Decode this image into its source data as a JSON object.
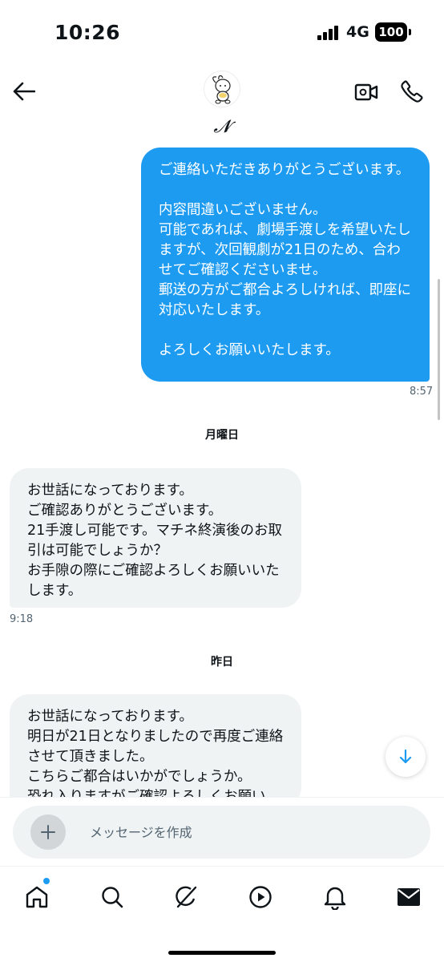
{
  "status_bar": {
    "time": "10:26",
    "network": "4G",
    "battery": "100"
  },
  "header": {
    "contact_name": "𝓝",
    "back_icon": "arrow-left-icon",
    "video_icon": "video-call-icon",
    "call_icon": "phone-icon"
  },
  "messages": [
    {
      "direction": "sent",
      "text": "ご連絡いただきありがとうございます。\n\n内容間違いございません。\n可能であれば、劇場手渡しを希望いたしますが、次回観劇が21日のため、合わせてご確認くださいませ。\n郵送の方がご都合よろしければ、即座に対応いたします。\n\nよろしくお願いいたします。",
      "time": "8:57"
    },
    {
      "day_label": "月曜日"
    },
    {
      "direction": "received",
      "text": "お世話になっております。\nご確認ありがとうございます。\n21手渡し可能です。マチネ終演後のお取引は可能でしょうか？\nお手隙の際にご確認よろしくお願いいたします。",
      "time": "9:18"
    },
    {
      "day_label": "昨日"
    },
    {
      "direction": "received",
      "text": "お世話になっております。\n明日が21日となりましたので再度ご連絡させて頂きました。\nこちらご都合はいかがでしょうか。\n恐れ入りますがご確認よろしくお願い"
    }
  ],
  "composer": {
    "placeholder": "メッセージを作成",
    "add_icon": "plus-icon",
    "voice_icon": "voice-waveform-icon"
  },
  "tabbar": {
    "items": [
      "home-icon",
      "search-icon",
      "grok-icon",
      "video-play-icon",
      "bell-icon",
      "mail-icon"
    ],
    "accent": "#1d9bf0"
  },
  "colors": {
    "sent_bubble": "#1d9bf0",
    "received_bubble": "#eff3f4"
  }
}
